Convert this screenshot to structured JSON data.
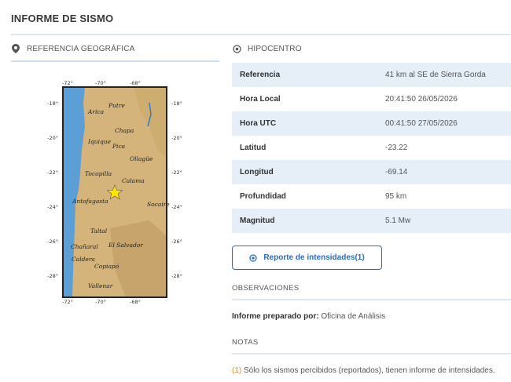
{
  "page": {
    "title": "INFORME DE SISMO"
  },
  "geo": {
    "heading": "REFERENCIA GEOGRÁFICA",
    "icon": "map-pin-icon",
    "map": {
      "top_ticks": [
        "-72°",
        "-70°",
        "-68°"
      ],
      "bottom_ticks": [
        "-72°",
        "-70°",
        "-68°"
      ],
      "left_ticks": [
        "-18°",
        "-20°",
        "-22°",
        "-24°",
        "-26°",
        "-28°"
      ],
      "right_ticks": [
        "-18°",
        "-20°",
        "-22°",
        "-24°",
        "-26°",
        "-28°"
      ],
      "places": [
        "Putre",
        "Arica",
        "Chapa",
        "Iquique",
        "Pica",
        "Ollagüe",
        "Tocopilla",
        "Calama",
        "Antofagasta",
        "Socaire",
        "Taltal",
        "Chañaral",
        "El Salvador",
        "Caldera",
        "Copiapó",
        "Vallenar"
      ],
      "epicenter_marker": "star-icon"
    }
  },
  "hypo": {
    "heading": "HIPOCENTRO",
    "icon": "target-icon",
    "rows": [
      {
        "label": "Referencia",
        "value": "41 km al SE de Sierra Gorda"
      },
      {
        "label": "Hora Local",
        "value": "20:41:50 26/05/2026"
      },
      {
        "label": "Hora UTC",
        "value": "00:41:50 27/05/2026"
      },
      {
        "label": "Latitud",
        "value": "-23.22"
      },
      {
        "label": "Longitud",
        "value": "-69.14"
      },
      {
        "label": "Profundidad",
        "value": "95 km"
      },
      {
        "label": "Magnitud",
        "value": "5.1 Mw"
      }
    ]
  },
  "intensity_button": {
    "label": "Reporte de intensidades(1)",
    "icon": "target-icon"
  },
  "observations": {
    "heading": "OBSERVACIONES",
    "prepared_label": "Informe preparado por:",
    "prepared_value": "Oficina de Análisis"
  },
  "notes": {
    "heading": "NOTAS",
    "number": "(1)",
    "text": "Sólo los sismos percibidos (reportados), tienen informe de intensidades."
  },
  "colors": {
    "accent": "#2a6cbb",
    "row_alt": "#e6eef8",
    "note_num": "#e08a2c",
    "ocean": "#5b9fd6",
    "land": "#d4b47a"
  }
}
